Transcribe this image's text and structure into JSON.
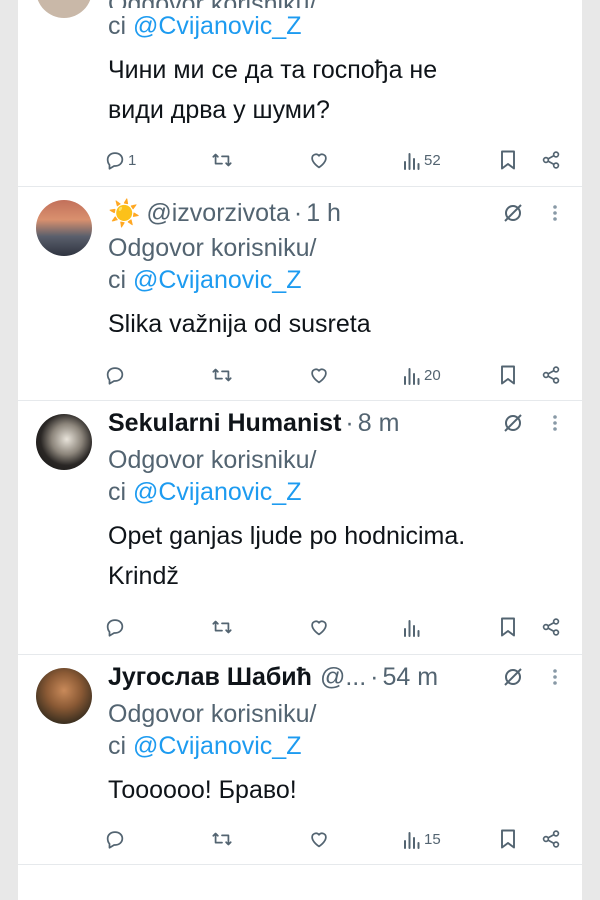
{
  "tweets": [
    {
      "id": "t0",
      "reply_prefix": "ci ",
      "mention": "@Cvijanovic_Z",
      "text_lines": [
        "Чини ми се да та госпођа не",
        "види дрва у шуми?"
      ],
      "replies": "1",
      "views": "52"
    },
    {
      "id": "t1",
      "emoji": "☀️",
      "handle": "@izvorzivota",
      "time": "1 h",
      "reply_line1": "Odgovor korisniku/",
      "reply_prefix": "ci ",
      "mention": "@Cvijanovic_Z",
      "text_lines": [
        "Slika važnija od susreta"
      ],
      "views": "20"
    },
    {
      "id": "t2",
      "name": "Sekularni Humanist",
      "time": "8 m",
      "reply_line1": "Odgovor korisniku/",
      "reply_prefix": "ci ",
      "mention": "@Cvijanovic_Z",
      "text_lines": [
        "Opet ganjas ljude po hodnicima.",
        "Krindž"
      ],
      "views": ""
    },
    {
      "id": "t3",
      "name": "Југослав Шабић",
      "handle": "@...",
      "time": "54 m",
      "reply_line1": "Odgovor korisniku/",
      "reply_prefix": "ci ",
      "mention": "@Cvijanovic_Z",
      "text_lines": [
        "Тоооооо! Браво!"
      ],
      "views": "15"
    }
  ],
  "partial_top_text": "Odgovor korisniku/",
  "separator": "·",
  "colors": {
    "link": "#1d9bf0",
    "text": "#0f1419",
    "muted": "#536471",
    "divider": "#e6e9ec"
  }
}
